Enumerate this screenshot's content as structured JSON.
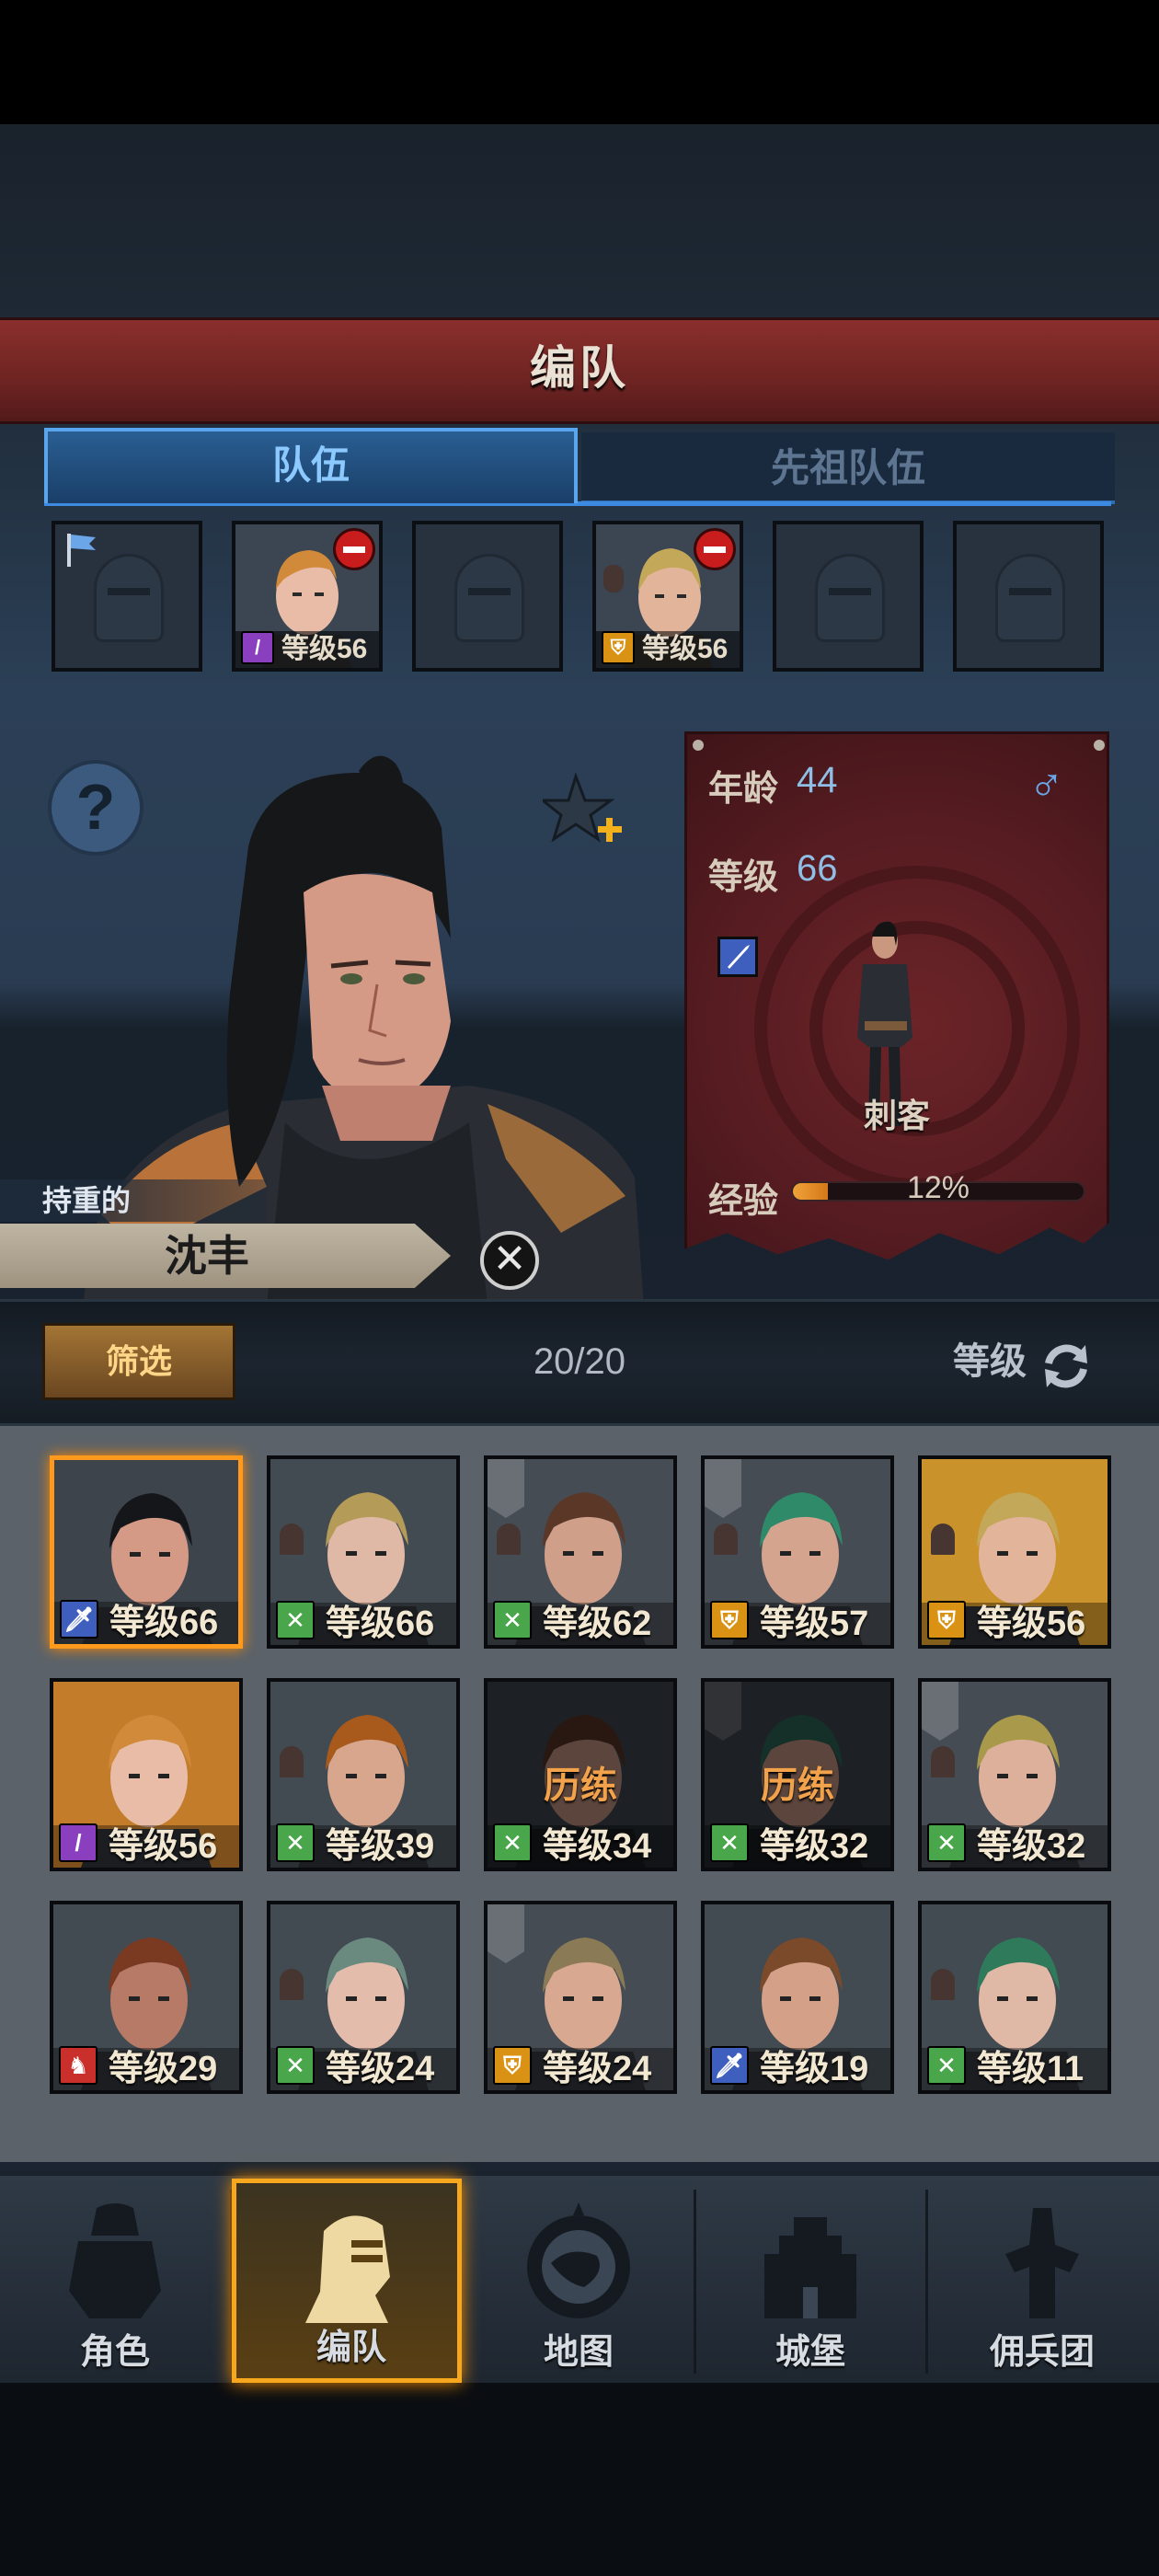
{
  "header": {
    "title": "编队"
  },
  "tabs": [
    {
      "label": "队伍",
      "active": true
    },
    {
      "label": "先祖队伍",
      "active": false
    }
  ],
  "party_slots": [
    {
      "empty": true,
      "flag": true
    },
    {
      "empty": false,
      "level_text": "等级56",
      "class_icon": "staff-icon",
      "class_color": "#8a3fbf",
      "removable": true
    },
    {
      "empty": true
    },
    {
      "empty": false,
      "level_text": "等级56",
      "class_icon": "shield-icon",
      "class_color": "#d99214",
      "removable": true
    },
    {
      "empty": true
    },
    {
      "empty": true
    }
  ],
  "hero": {
    "trait": "持重的",
    "name": "沈丰",
    "age_label": "年龄",
    "age": "44",
    "level_label": "等级",
    "level": "66",
    "gender_icon": "♂",
    "class_name": "刺客",
    "exp_label": "经验",
    "exp_percent_text": "12%",
    "exp_fraction": 0.12
  },
  "filter_bar": {
    "filter_label": "筛选",
    "count": "20/20",
    "sort_label": "等级"
  },
  "roster": [
    {
      "level_text": "等级66",
      "class_color": "#3f5fbf",
      "class_glyph": "🗡",
      "bg": "#3d444c",
      "hair": "#15161a",
      "skin": "#d49a86",
      "selected": true
    },
    {
      "level_text": "等级66",
      "class_color": "#4aa64a",
      "class_glyph": "✕",
      "bg": "#424a52",
      "hair": "#b49b58",
      "skin": "#e0b8a6",
      "guard": true
    },
    {
      "level_text": "等级62",
      "class_color": "#4aa64a",
      "class_glyph": "✕",
      "bg": "#454c54",
      "hair": "#5a3726",
      "skin": "#cf9f8a",
      "banner": true,
      "guard": true
    },
    {
      "level_text": "等级57",
      "class_color": "#d99214",
      "class_glyph": "⛨",
      "bg": "#454c54",
      "hair": "#2f8a6a",
      "skin": "#d4a48e",
      "banner": true,
      "guard": true
    },
    {
      "level_text": "等级56",
      "class_color": "#d99214",
      "class_glyph": "⛨",
      "bg": "#c9922a",
      "hair": "#c4a85a",
      "skin": "#e2b59a",
      "guard": true
    },
    {
      "level_text": "等级56",
      "class_color": "#8a3fbf",
      "class_glyph": "/",
      "bg": "#c27c2a",
      "hair": "#d08a3a",
      "skin": "#e8bca6"
    },
    {
      "level_text": "等级39",
      "class_color": "#4aa64a",
      "class_glyph": "✕",
      "bg": "#424a52",
      "hair": "#a85a1c",
      "skin": "#d8a68c",
      "guard": true
    },
    {
      "level_text": "等级34",
      "class_color": "#4aa64a",
      "class_glyph": "✕",
      "bg": "#424a52",
      "hair": "#5a3726",
      "skin": "#c99a86",
      "training": "历练"
    },
    {
      "level_text": "等级32",
      "class_color": "#4aa64a",
      "class_glyph": "✕",
      "bg": "#424a52",
      "hair": "#2f6a5a",
      "skin": "#c99a86",
      "training": "历练",
      "banner": true
    },
    {
      "level_text": "等级32",
      "class_color": "#4aa64a",
      "class_glyph": "✕",
      "bg": "#454c54",
      "hair": "#a89a4a",
      "skin": "#dcb09a",
      "banner": true,
      "guard": true
    },
    {
      "level_text": "等级29",
      "class_color": "#c9302c",
      "class_glyph": "♞",
      "bg": "#424a52",
      "hair": "#7a3a22",
      "skin": "#b67a66"
    },
    {
      "level_text": "等级24",
      "class_color": "#4aa64a",
      "class_glyph": "✕",
      "bg": "#424a52",
      "hair": "#6a8a80",
      "skin": "#e4bcac",
      "guard": true
    },
    {
      "level_text": "等级24",
      "class_color": "#d99214",
      "class_glyph": "⛨",
      "bg": "#454c54",
      "hair": "#8a7a56",
      "skin": "#d8a890",
      "banner": true
    },
    {
      "level_text": "等级19",
      "class_color": "#3f5fbf",
      "class_glyph": "🗡",
      "bg": "#424a52",
      "hair": "#7a4a2a",
      "skin": "#d4a088"
    },
    {
      "level_text": "等级11",
      "class_color": "#4aa64a",
      "class_glyph": "✕",
      "bg": "#424a52",
      "hair": "#2f7a5a",
      "skin": "#e0b8a6",
      "guard": true
    }
  ],
  "nav": [
    {
      "label": "角色",
      "icon": "knight-icon",
      "active": false
    },
    {
      "label": "编队",
      "icon": "helmet-icon",
      "active": true
    },
    {
      "label": "地图",
      "icon": "compass-icon",
      "active": false
    },
    {
      "label": "城堡",
      "icon": "castle-icon",
      "active": false
    },
    {
      "label": "佣兵团",
      "icon": "mercenary-icon",
      "active": false
    }
  ]
}
